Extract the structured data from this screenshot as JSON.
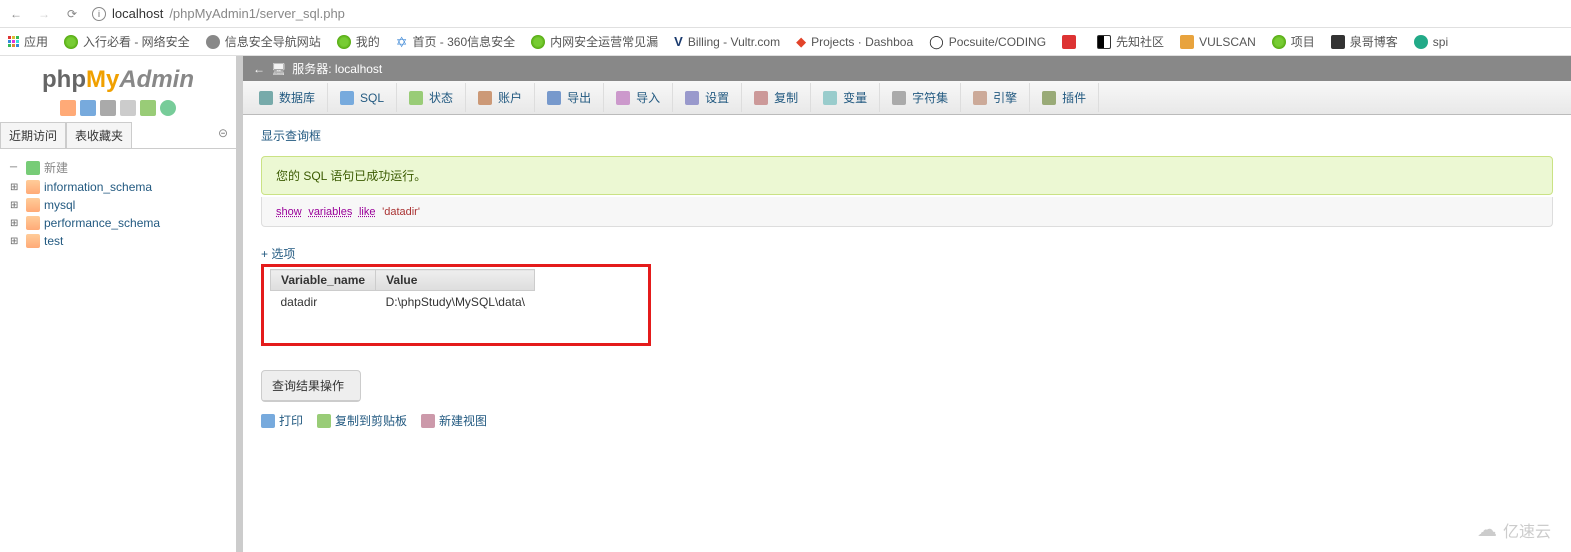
{
  "browser": {
    "url_host": "localhost",
    "url_path": "/phpMyAdmin1/server_sql.php"
  },
  "bookmarks": {
    "apps": "应用",
    "items": [
      "入行必看 - 网络安全",
      "信息安全导航网站",
      "我的",
      "首页 - 360信息安全",
      "内网安全运营常见漏",
      "Billing - Vultr.com",
      "Projects · Dashboa",
      "Pocsuite/CODING",
      "",
      "先知社区",
      "VULSCAN",
      "项目",
      "泉哥博客",
      "spi"
    ]
  },
  "logo": {
    "a": "php",
    "b": "My",
    "c": "Admin"
  },
  "side_tabs": {
    "recent": "近期访问",
    "fav": "表收藏夹"
  },
  "db_tree": {
    "new": "新建",
    "items": [
      "information_schema",
      "mysql",
      "performance_schema",
      "test"
    ]
  },
  "server_label": "服务器: localhost",
  "tabs": [
    "数据库",
    "SQL",
    "状态",
    "账户",
    "导出",
    "导入",
    "设置",
    "复制",
    "变量",
    "字符集",
    "引擎",
    "插件"
  ],
  "content": {
    "show_query": "显示查询框",
    "success_msg": "您的 SQL 语句已成功运行。",
    "sql_parts": {
      "kw1": "show",
      "kw2": "variables",
      "kw3": "like",
      "str": "'datadir'"
    },
    "options": "+ 选项",
    "table": {
      "headers": [
        "Variable_name",
        "Value"
      ],
      "row": [
        "datadir",
        "D:\\phpStudy\\MySQL\\data\\"
      ]
    },
    "ops_title": "查询结果操作",
    "ops": [
      "打印",
      "复制到剪贴板",
      "新建视图"
    ]
  },
  "watermark": "亿速云"
}
